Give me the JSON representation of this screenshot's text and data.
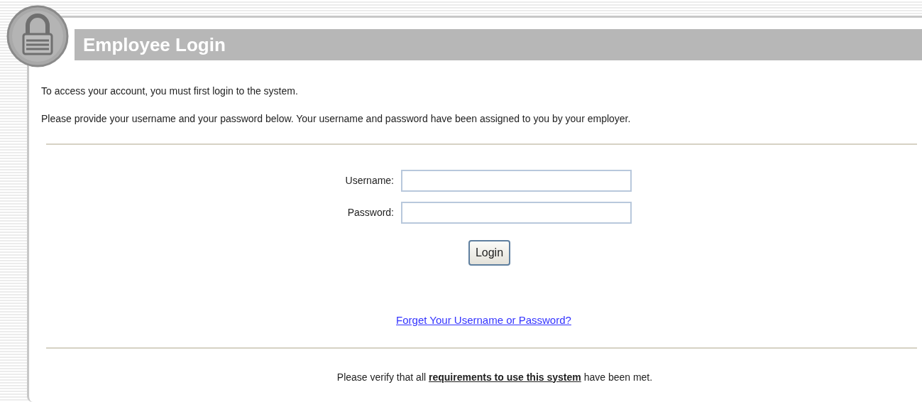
{
  "header": {
    "title": "Employee Login"
  },
  "intro": [
    "To access your account, you must first login to the system.",
    "Please provide your username and your password below. Your username and password have been assigned to you by your employer."
  ],
  "form": {
    "fields": [
      {
        "label": "Username:"
      },
      {
        "label": "Password:"
      }
    ],
    "button": "Login"
  },
  "forgot_link": "Forget Your Username or Password?",
  "footer": {
    "before": "Please verify that all ",
    "link": "requirements to use this system",
    "after": " have been met."
  }
}
